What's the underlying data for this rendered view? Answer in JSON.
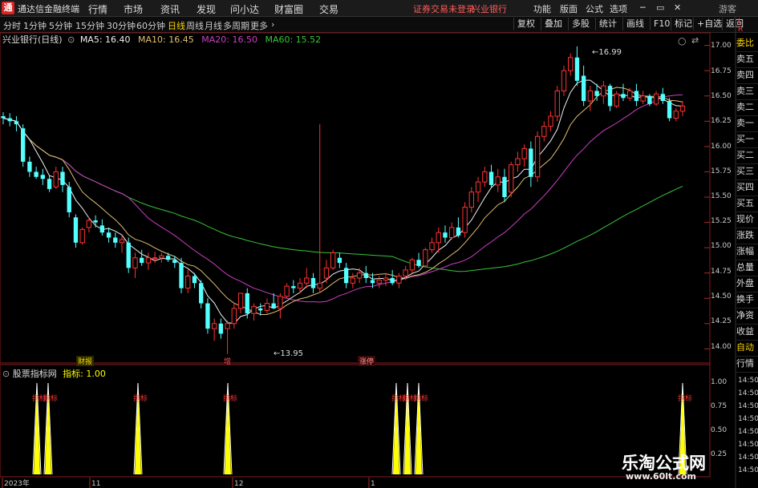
{
  "app": {
    "name": "通达信金融终端"
  },
  "menu": [
    "行情",
    "市场",
    "资讯",
    "发现",
    "问小达",
    "财富圈",
    "交易"
  ],
  "alert": {
    "text": "证券交易未登录",
    "stock": "兴业银行"
  },
  "top_right": [
    "功能",
    "版面",
    "公式",
    "选项"
  ],
  "window_controls": [
    "─",
    "▭",
    "✕"
  ],
  "guest": "游客",
  "periods": [
    "分时",
    "1分钟",
    "5分钟",
    "15分钟",
    "30分钟",
    "60分钟",
    "日线",
    "周线",
    "月线",
    "多周期",
    "更多"
  ],
  "selected_period": "日线",
  "toolbar": [
    "复权",
    "叠加",
    "多股",
    "统计",
    "画线",
    "F10",
    "标记",
    "+自选",
    "返回"
  ],
  "ma": {
    "title": "兴业银行(日线)",
    "ma5": "MA5: 16.40",
    "ma10": "MA10: 16.45",
    "ma20": "MA20: 16.50",
    "ma60": "MA60: 15.52"
  },
  "indicator": {
    "name": "股票指标网",
    "value": "指标: 1.00",
    "signal": "指标"
  },
  "y_ticks": [
    "17.00",
    "16.75",
    "16.50",
    "16.25",
    "16.00",
    "15.75",
    "15.50",
    "15.25",
    "15.00",
    "14.75",
    "14.50",
    "14.25",
    "14.00"
  ],
  "ind_ticks": [
    "1.00",
    "0.75",
    "0.50",
    "0.25"
  ],
  "price_labels": {
    "high": "16.99",
    "low": "13.95"
  },
  "x_labels": [
    "2023年",
    "11",
    "12",
    "1"
  ],
  "event_tags": [
    "财报",
    "增",
    "涨停"
  ],
  "sidebar": [
    "委比",
    "卖五",
    "卖四",
    "卖三",
    "卖二",
    "卖一",
    "买一",
    "买二",
    "买三",
    "买四",
    "买五",
    "现价",
    "涨跌",
    "涨幅",
    "总量",
    "外盘",
    "换手",
    "净资",
    "收益",
    "自动",
    "行情"
  ],
  "right_ticks": [
    "14:50",
    "14:50",
    "14:50",
    "14:50",
    "14:50",
    "14:50",
    "14:50",
    "14:50"
  ],
  "watermark": {
    "title": "乐淘公式网",
    "url": "www.60lt.com"
  },
  "colors": {
    "up": "#ff3232",
    "down": "#54ffff",
    "ma5": "#f0f0f0",
    "ma10": "#e0c070",
    "ma20": "#cc3fc4",
    "ma60": "#38c538",
    "signal": "#ffff00"
  },
  "chart_data": {
    "type": "candlestick",
    "ylim": [
      13.9,
      17.1
    ],
    "ohlc": [
      [
        16.3,
        16.34,
        16.22,
        16.28
      ],
      [
        16.28,
        16.33,
        16.2,
        16.25
      ],
      [
        16.25,
        16.3,
        16.15,
        16.22
      ],
      [
        16.18,
        16.22,
        15.8,
        15.85
      ],
      [
        15.85,
        15.9,
        15.7,
        15.75
      ],
      [
        15.75,
        15.8,
        15.68,
        15.7
      ],
      [
        15.72,
        15.78,
        15.62,
        15.68
      ],
      [
        15.68,
        15.72,
        15.55,
        15.58
      ],
      [
        15.6,
        15.8,
        15.58,
        15.75
      ],
      [
        15.75,
        15.8,
        15.55,
        15.62
      ],
      [
        15.6,
        15.65,
        15.3,
        15.35
      ],
      [
        15.3,
        15.33,
        15.0,
        15.05
      ],
      [
        15.05,
        15.2,
        15.03,
        15.18
      ],
      [
        15.2,
        15.3,
        15.15,
        15.27
      ],
      [
        15.27,
        15.32,
        15.2,
        15.25
      ],
      [
        15.22,
        15.28,
        15.12,
        15.15
      ],
      [
        15.15,
        15.2,
        15.05,
        15.1
      ],
      [
        15.1,
        15.15,
        15.0,
        15.05
      ],
      [
        15.05,
        15.12,
        14.95,
        15.08
      ],
      [
        15.05,
        15.1,
        14.75,
        14.8
      ],
      [
        14.8,
        14.95,
        14.7,
        14.9
      ],
      [
        14.9,
        14.98,
        14.82,
        14.85
      ],
      [
        14.85,
        14.95,
        14.78,
        14.9
      ],
      [
        14.9,
        14.96,
        14.85,
        14.9
      ],
      [
        14.9,
        14.95,
        14.85,
        14.92
      ],
      [
        14.92,
        14.95,
        14.86,
        14.88
      ],
      [
        14.88,
        14.92,
        14.8,
        14.85
      ],
      [
        14.85,
        14.9,
        14.55,
        14.6
      ],
      [
        14.6,
        14.78,
        14.55,
        14.72
      ],
      [
        14.72,
        14.75,
        14.6,
        14.65
      ],
      [
        14.65,
        14.68,
        14.4,
        14.45
      ],
      [
        14.45,
        14.5,
        14.15,
        14.2
      ],
      [
        14.2,
        14.3,
        14.08,
        14.25
      ],
      [
        14.25,
        14.3,
        14.1,
        14.15
      ],
      [
        14.2,
        14.28,
        13.95,
        14.25
      ],
      [
        14.25,
        14.45,
        14.2,
        14.4
      ],
      [
        14.4,
        14.55,
        14.35,
        14.55
      ],
      [
        14.55,
        14.6,
        14.3,
        14.35
      ],
      [
        14.35,
        14.45,
        14.28,
        14.42
      ],
      [
        14.4,
        14.45,
        14.33,
        14.38
      ],
      [
        14.38,
        14.5,
        14.35,
        14.45
      ],
      [
        14.45,
        14.55,
        14.4,
        14.4
      ],
      [
        14.4,
        14.55,
        14.3,
        14.52
      ],
      [
        14.52,
        14.65,
        14.5,
        14.62
      ],
      [
        14.62,
        14.68,
        14.55,
        14.6
      ],
      [
        14.6,
        14.7,
        14.55,
        14.65
      ],
      [
        14.65,
        14.8,
        14.6,
        14.7
      ],
      [
        14.7,
        14.75,
        14.55,
        14.6
      ],
      [
        14.6,
        16.22,
        14.55,
        14.65
      ],
      [
        14.7,
        14.88,
        14.65,
        14.8
      ],
      [
        14.8,
        14.98,
        14.78,
        14.95
      ],
      [
        14.9,
        14.95,
        14.8,
        14.85
      ],
      [
        14.8,
        14.85,
        14.6,
        14.65
      ],
      [
        14.65,
        14.75,
        14.6,
        14.7
      ],
      [
        14.7,
        14.8,
        14.65,
        14.75
      ],
      [
        14.75,
        14.82,
        14.65,
        14.7
      ],
      [
        14.68,
        14.75,
        14.6,
        14.65
      ],
      [
        14.65,
        14.72,
        14.6,
        14.68
      ],
      [
        14.68,
        14.75,
        14.62,
        14.7
      ],
      [
        14.7,
        14.78,
        14.63,
        14.65
      ],
      [
        14.65,
        14.75,
        14.6,
        14.72
      ],
      [
        14.72,
        14.82,
        14.68,
        14.78
      ],
      [
        14.78,
        14.9,
        14.75,
        14.88
      ],
      [
        14.88,
        14.95,
        14.8,
        14.82
      ],
      [
        14.82,
        15.0,
        14.8,
        14.98
      ],
      [
        14.98,
        15.1,
        14.95,
        15.05
      ],
      [
        15.05,
        15.2,
        14.95,
        15.15
      ],
      [
        15.15,
        15.22,
        15.05,
        15.1
      ],
      [
        15.1,
        15.25,
        15.08,
        15.2
      ],
      [
        15.2,
        15.3,
        15.1,
        15.12
      ],
      [
        15.15,
        15.45,
        15.1,
        15.4
      ],
      [
        15.4,
        15.6,
        15.35,
        15.55
      ],
      [
        15.55,
        15.7,
        15.45,
        15.65
      ],
      [
        15.65,
        15.8,
        15.6,
        15.75
      ],
      [
        15.75,
        15.82,
        15.6,
        15.62
      ],
      [
        15.62,
        15.78,
        15.55,
        15.7
      ],
      [
        15.7,
        15.78,
        15.45,
        15.5
      ],
      [
        15.55,
        15.85,
        15.5,
        15.82
      ],
      [
        15.82,
        15.95,
        15.75,
        15.88
      ],
      [
        15.88,
        16.02,
        15.8,
        15.98
      ],
      [
        15.98,
        16.05,
        15.6,
        15.7
      ],
      [
        15.7,
        16.15,
        15.65,
        16.1
      ],
      [
        16.1,
        16.25,
        16.05,
        16.2
      ],
      [
        16.2,
        16.35,
        16.15,
        16.3
      ],
      [
        16.3,
        16.6,
        16.25,
        16.55
      ],
      [
        16.55,
        16.8,
        16.5,
        16.75
      ],
      [
        16.75,
        16.92,
        16.7,
        16.88
      ],
      [
        16.88,
        16.99,
        16.6,
        16.65
      ],
      [
        16.7,
        16.8,
        16.4,
        16.45
      ],
      [
        16.45,
        16.6,
        16.35,
        16.55
      ],
      [
        16.55,
        16.62,
        16.45,
        16.5
      ],
      [
        16.5,
        16.65,
        16.42,
        16.6
      ],
      [
        16.6,
        16.62,
        16.35,
        16.4
      ],
      [
        16.4,
        16.55,
        16.38,
        16.52
      ],
      [
        16.52,
        16.62,
        16.45,
        16.48
      ],
      [
        16.48,
        16.58,
        16.45,
        16.55
      ],
      [
        16.55,
        16.62,
        16.4,
        16.45
      ],
      [
        16.45,
        16.55,
        16.42,
        16.5
      ],
      [
        16.5,
        16.52,
        16.4,
        16.42
      ],
      [
        16.42,
        16.55,
        16.4,
        16.52
      ],
      [
        16.52,
        16.58,
        16.42,
        16.45
      ],
      [
        16.45,
        16.48,
        16.25,
        16.28
      ],
      [
        16.28,
        16.38,
        16.25,
        16.35
      ],
      [
        16.35,
        16.45,
        16.3,
        16.4
      ]
    ],
    "signals": [
      6,
      8,
      24,
      40,
      70,
      72,
      74,
      121
    ]
  }
}
